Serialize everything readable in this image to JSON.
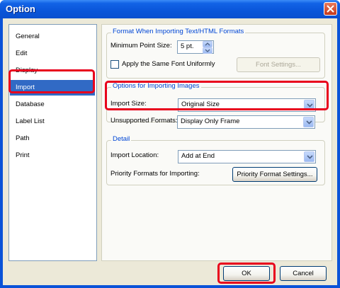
{
  "window": {
    "title": "Option"
  },
  "sidebar": {
    "items": [
      {
        "label": "General"
      },
      {
        "label": "Edit"
      },
      {
        "label": "Display"
      },
      {
        "label": "Import"
      },
      {
        "label": "Database"
      },
      {
        "label": "Label List"
      },
      {
        "label": "Path"
      },
      {
        "label": "Print"
      }
    ],
    "selected": "Import"
  },
  "format_group": {
    "title": "Format When Importing Text/HTML Formats",
    "min_point_label": "Minimum Point Size:",
    "min_point_value": "5 pt.",
    "apply_font_label": "Apply the Same Font Uniformly",
    "apply_font_checked": false,
    "font_settings_button": "Font Settings..."
  },
  "images_group": {
    "title": "Options for Importing Images",
    "import_size_label": "Import Size:",
    "import_size_value": "Original Size"
  },
  "unsupported": {
    "label": "Unsupported Formats:",
    "value": "Display Only Frame"
  },
  "detail_group": {
    "title": "Detail",
    "import_location_label": "Import Location:",
    "import_location_value": "Add at End",
    "priority_label": "Priority Formats for Importing:",
    "priority_button": "Priority Format Settings..."
  },
  "footer": {
    "ok": "OK",
    "cancel": "Cancel"
  },
  "colors": {
    "highlight": "#e8001c",
    "selection": "#316ac5",
    "group_title": "#0046d5"
  }
}
